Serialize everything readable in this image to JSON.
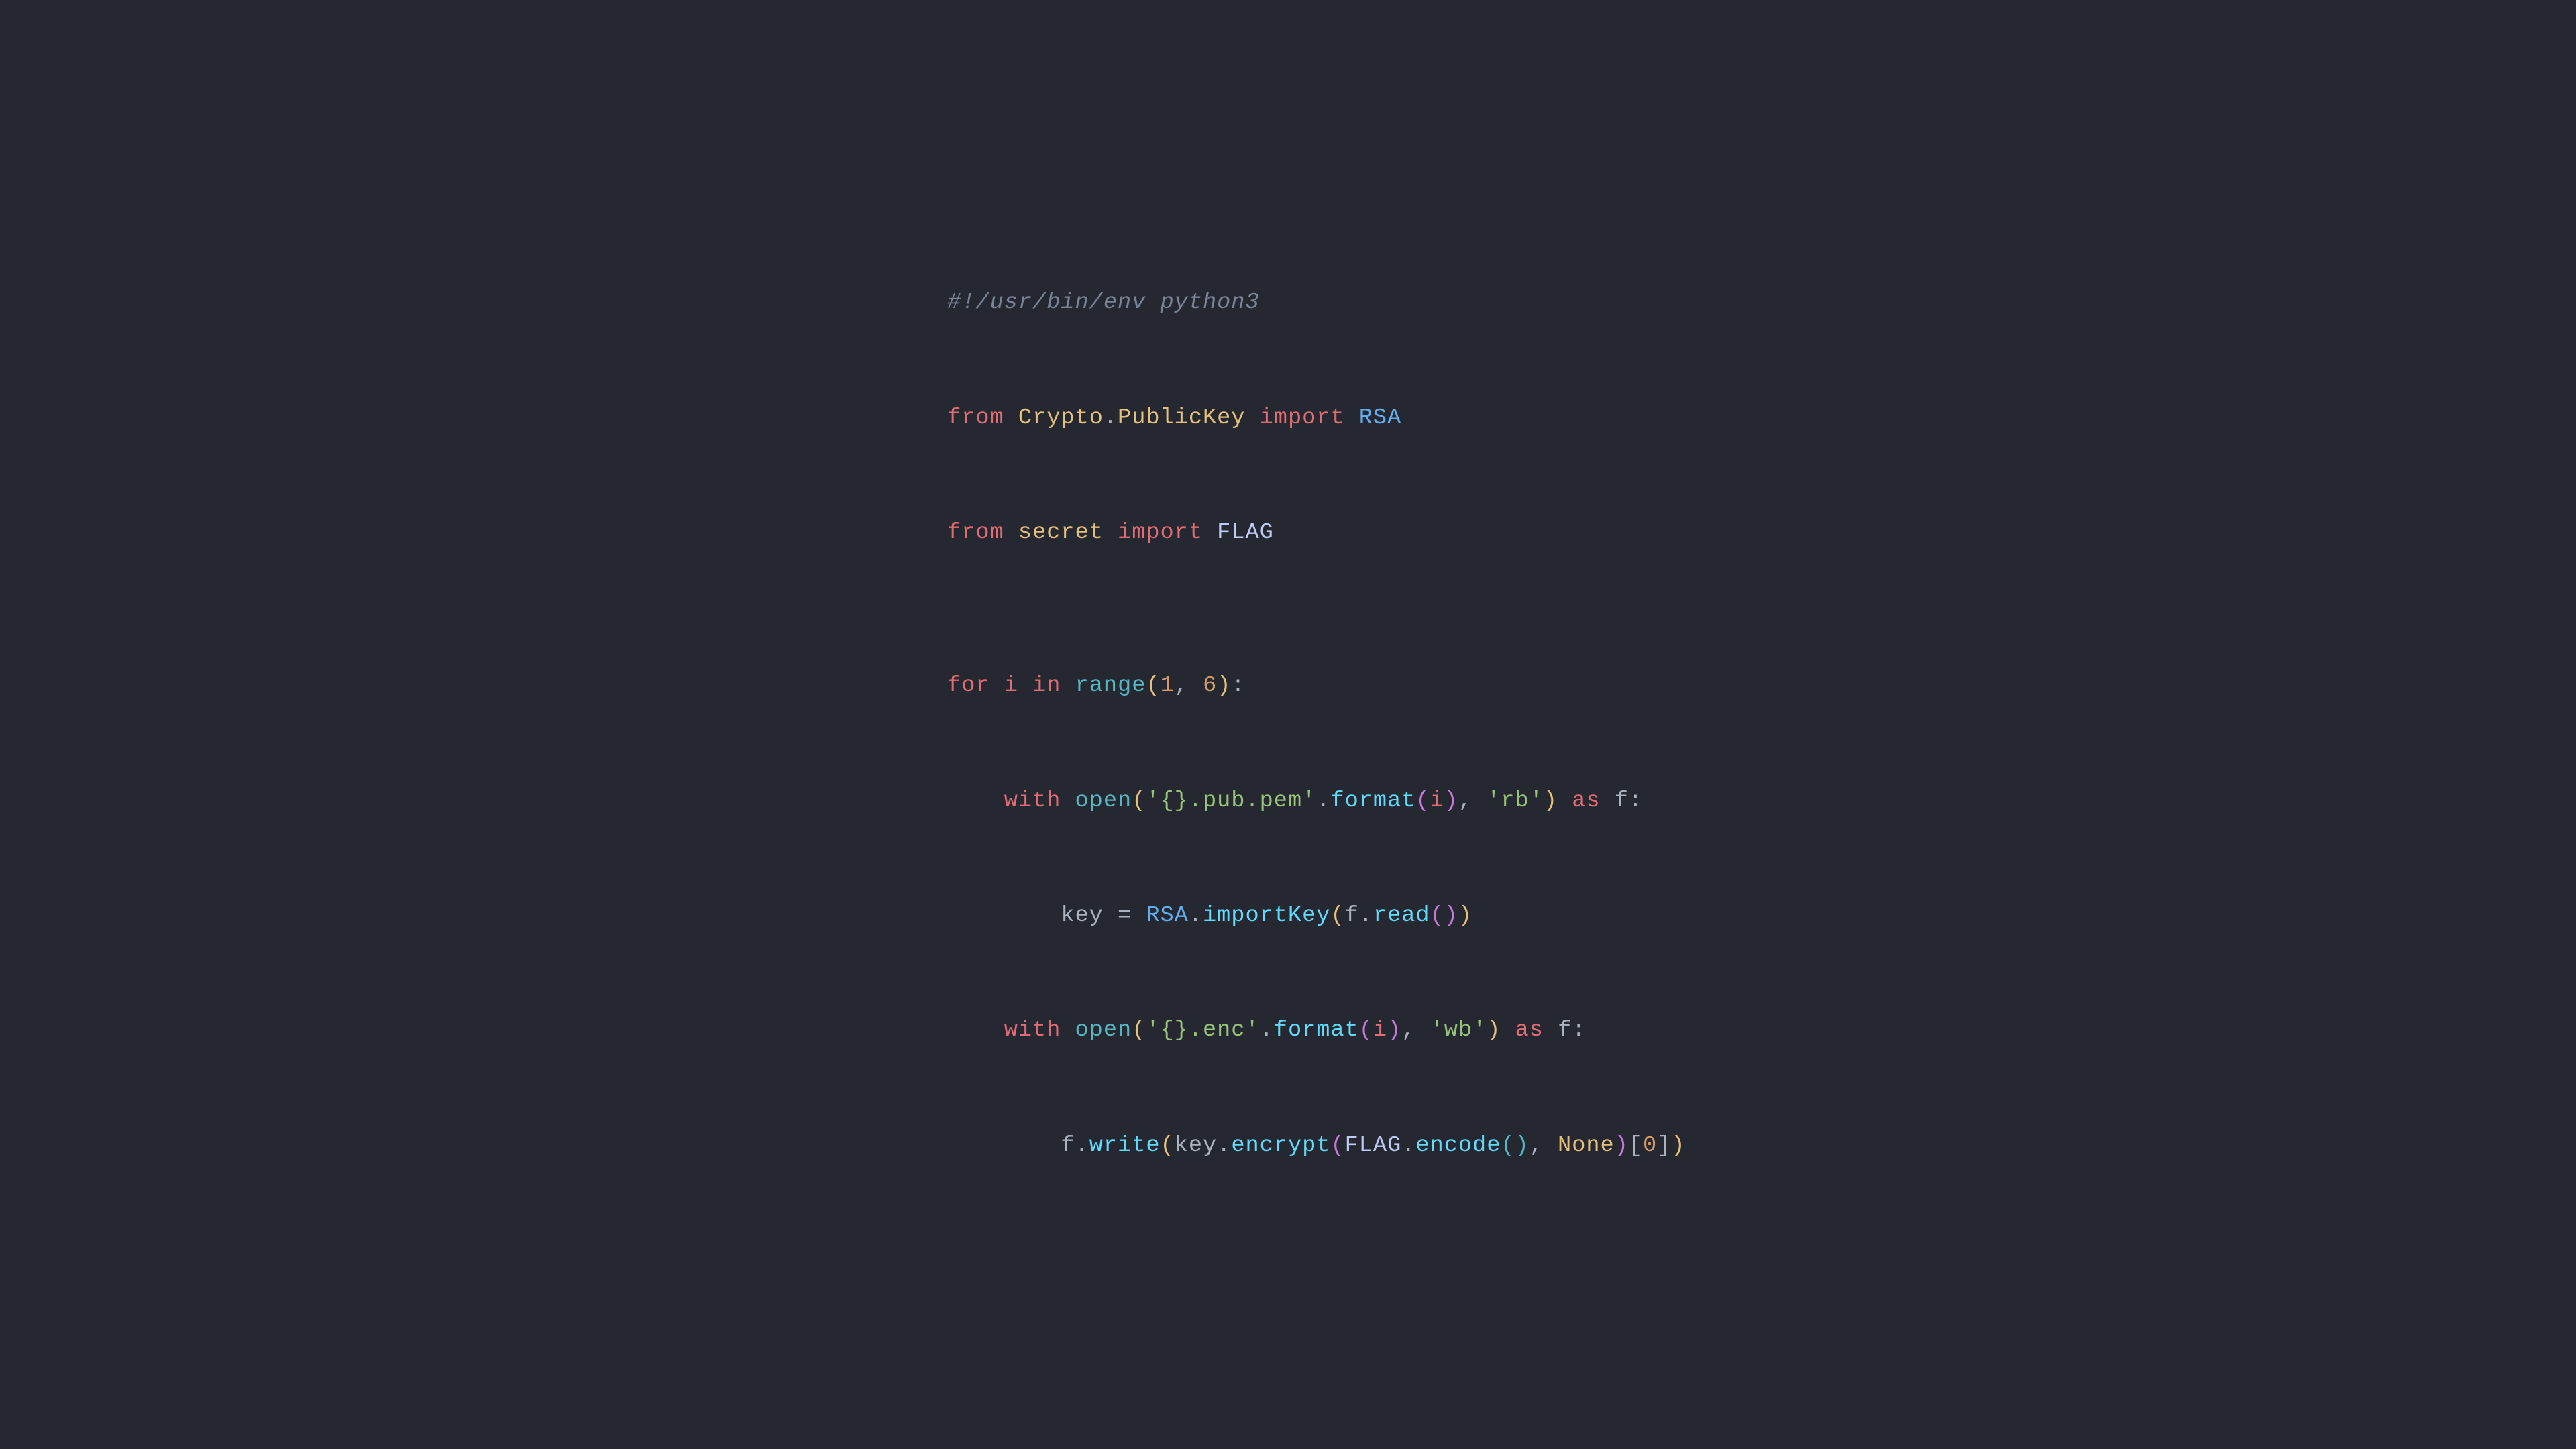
{
  "code": {
    "bg": "#252830",
    "lines": [
      {
        "id": "shebang",
        "text": "#!/usr/bin/env python3"
      },
      {
        "id": "import1",
        "text": "from Crypto.PublicKey import RSA"
      },
      {
        "id": "import2",
        "text": "from secret import FLAG"
      },
      {
        "id": "blank1",
        "text": ""
      },
      {
        "id": "for",
        "text": "for i in range(1, 6):"
      },
      {
        "id": "with1",
        "text": "    with open('{}.pub.pem'.format(i), 'rb') as f:"
      },
      {
        "id": "key",
        "text": "        key = RSA.importKey(f.read())"
      },
      {
        "id": "with2",
        "text": "    with open('{}.enc'.format(i), 'wb') as f:"
      },
      {
        "id": "write",
        "text": "        f.write(key.encrypt(FLAG.encode(), None)[0])"
      }
    ]
  }
}
